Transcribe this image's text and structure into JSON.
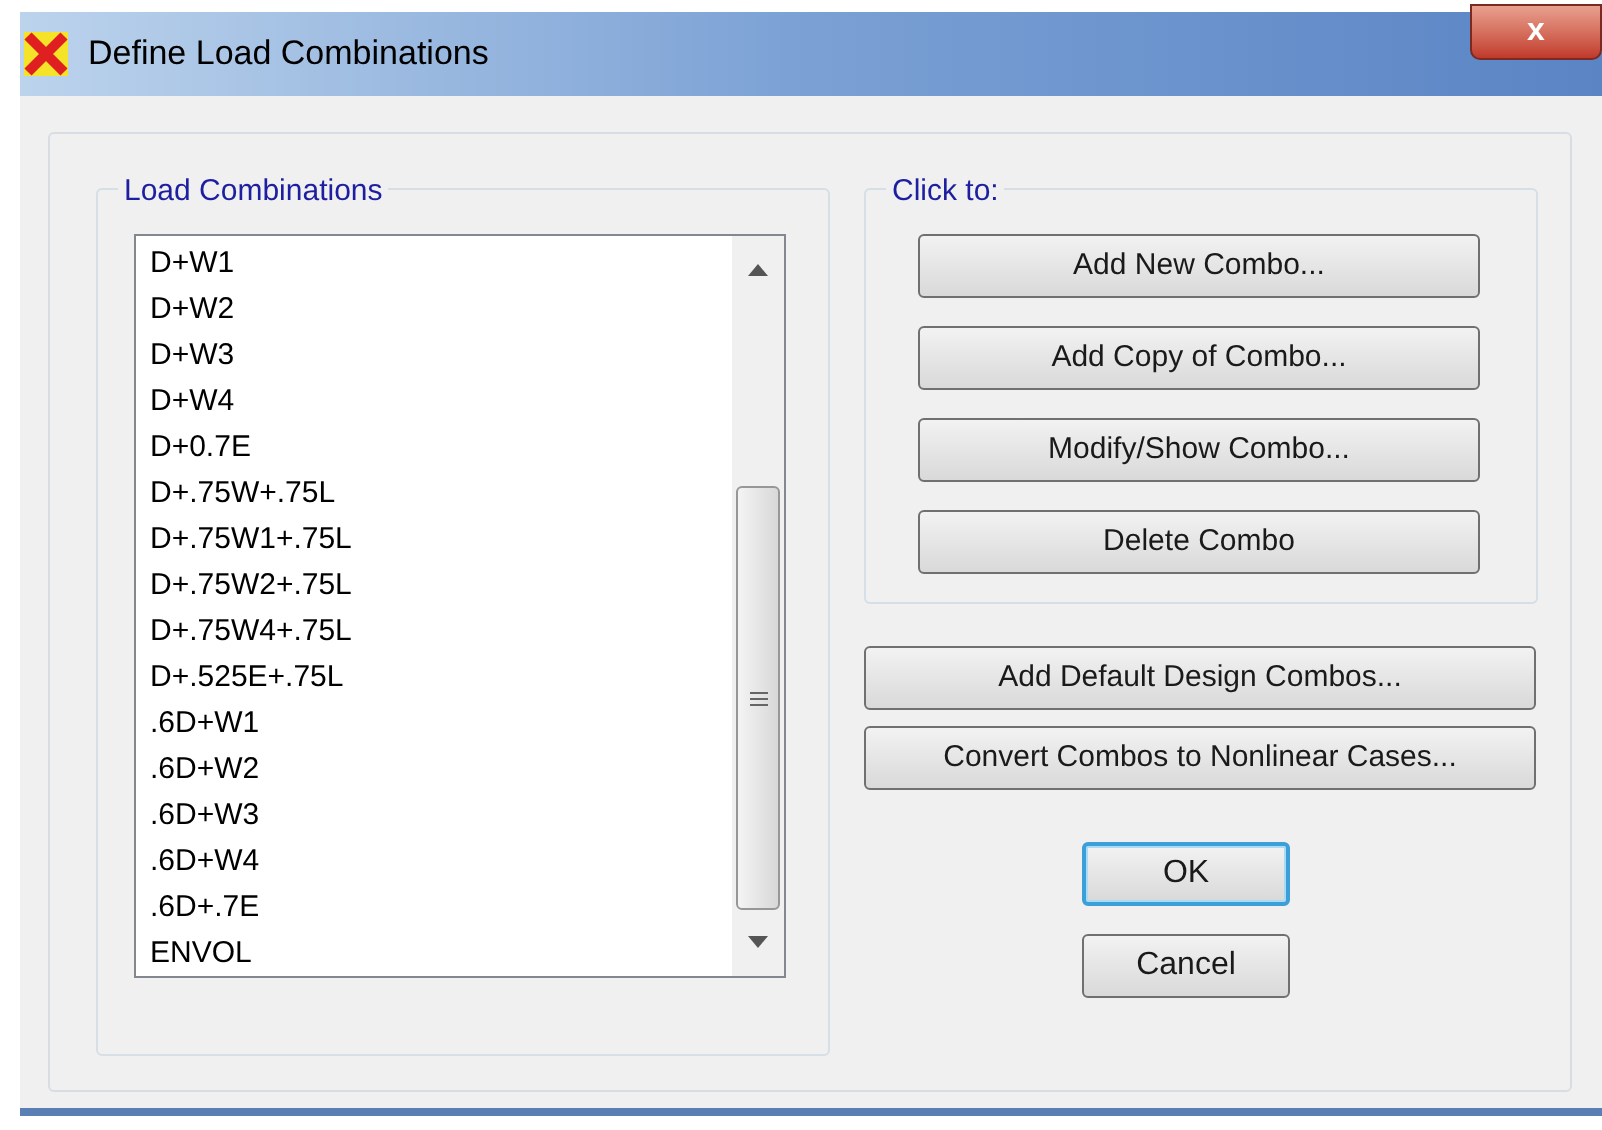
{
  "window": {
    "title": "Define Load Combinations",
    "close_label": "x"
  },
  "combinations": {
    "label": "Load Combinations",
    "items": [
      "D+W1",
      "D+W2",
      "D+W3",
      "D+W4",
      "D+0.7E",
      "D+.75W+.75L",
      "D+.75W1+.75L",
      "D+.75W2+.75L",
      "D+.75W4+.75L",
      "D+.525E+.75L",
      ".6D+W1",
      ".6D+W2",
      ".6D+W3",
      ".6D+W4",
      ".6D+.7E",
      "ENVOL"
    ]
  },
  "click_to": {
    "label": "Click to:",
    "buttons": [
      "Add New Combo...",
      "Add Copy of Combo...",
      "Modify/Show Combo...",
      "Delete Combo"
    ]
  },
  "extra_buttons": [
    "Add Default Design Combos...",
    "Convert Combos to Nonlinear Cases..."
  ],
  "dialog_buttons": [
    {
      "label": "OK",
      "focused": true
    },
    {
      "label": "Cancel",
      "focused": false
    }
  ]
}
